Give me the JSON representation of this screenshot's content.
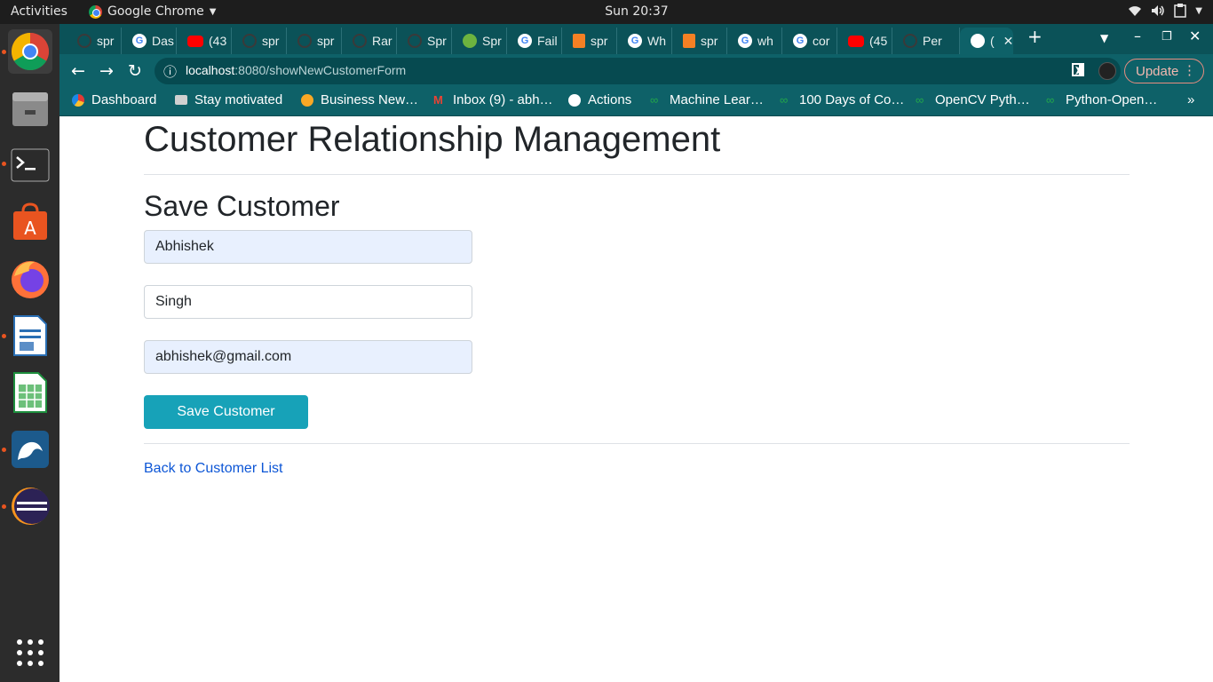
{
  "os": {
    "activities": "Activities",
    "app_name": "Google Chrome",
    "clock": "Sun 20:37"
  },
  "dock": {
    "apps": [
      "chrome-icon",
      "files-icon",
      "terminal-icon",
      "software-center-icon",
      "firefox-icon",
      "writer-icon",
      "calc-icon",
      "mysql-workbench-icon",
      "eclipse-icon",
      "app-grid-icon"
    ]
  },
  "browser": {
    "tabs": [
      {
        "label": "spr",
        "icon": "github-icon"
      },
      {
        "label": "Das",
        "icon": "google-icon"
      },
      {
        "label": "(43",
        "icon": "youtube-icon"
      },
      {
        "label": "spr",
        "icon": "github-icon"
      },
      {
        "label": "spr",
        "icon": "github-icon"
      },
      {
        "label": "Rar",
        "icon": "github-icon"
      },
      {
        "label": "Spr",
        "icon": "github-icon"
      },
      {
        "label": "Spr",
        "icon": "spring-icon"
      },
      {
        "label": "Fail",
        "icon": "google-icon"
      },
      {
        "label": "spr",
        "icon": "stackoverflow-icon"
      },
      {
        "label": "Wh",
        "icon": "google-icon"
      },
      {
        "label": "spr",
        "icon": "stackoverflow-icon"
      },
      {
        "label": "wh",
        "icon": "google-icon"
      },
      {
        "label": "cor",
        "icon": "google-icon"
      },
      {
        "label": "(45",
        "icon": "youtube-icon"
      },
      {
        "label": "Per",
        "icon": "github-icon"
      },
      {
        "label": "(",
        "icon": "globe-icon"
      }
    ],
    "url_host": "localhost",
    "url_rest": ":8080/showNewCustomerForm",
    "update_label": "Update",
    "bookmarks": [
      {
        "label": "Dashboard",
        "icon": "dashboard-icon"
      },
      {
        "label": "Stay motivated",
        "icon": "folder-icon"
      },
      {
        "label": "Business New…",
        "icon": "news-icon"
      },
      {
        "label": "Inbox (9) - abh…",
        "icon": "gmail-icon"
      },
      {
        "label": "Actions",
        "icon": "globe-icon"
      },
      {
        "label": "Machine Lear…",
        "icon": "infinity-icon"
      },
      {
        "label": "100 Days of Co…",
        "icon": "infinity-icon"
      },
      {
        "label": "OpenCV Pyth…",
        "icon": "infinity-icon"
      },
      {
        "label": "Python-Open…",
        "icon": "infinity-icon"
      }
    ],
    "more_bookmarks": "»"
  },
  "page": {
    "title": "Customer Relationship Management",
    "form_title": "Save Customer",
    "first_name": "Abhishek",
    "last_name": "Singh",
    "email": "abhishek@gmail.com",
    "save_button": "Save Customer",
    "back_link": "Back to Customer List"
  },
  "colors": {
    "chrome_frame": "#0b5258",
    "chrome_toolbar": "#0e6168",
    "save_button": "#17a2b8",
    "link": "#0d56d6"
  }
}
